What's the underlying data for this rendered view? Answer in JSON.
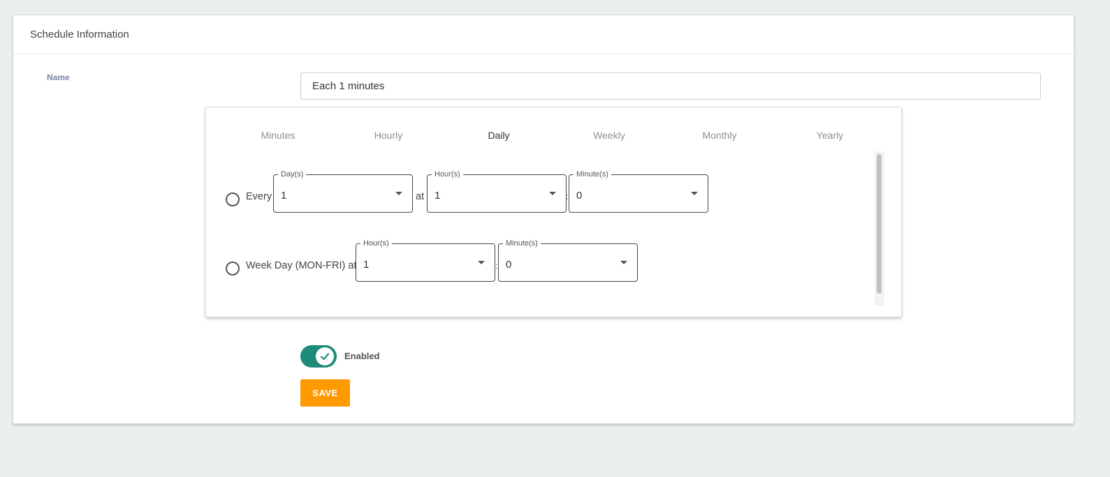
{
  "card": {
    "title": "Schedule Information"
  },
  "form": {
    "name_label": "Name",
    "name_value": "Each 1 minutes"
  },
  "cron": {
    "tabs": [
      {
        "label": "Minutes"
      },
      {
        "label": "Hourly"
      },
      {
        "label": "Daily"
      },
      {
        "label": "Weekly"
      },
      {
        "label": "Monthly"
      },
      {
        "label": "Yearly"
      }
    ],
    "active_tab": "Daily",
    "row1": {
      "prefix": "Every",
      "days": {
        "label": "Day(s)",
        "value": "1"
      },
      "at": "at",
      "hours": {
        "label": "Hour(s)",
        "value": "1"
      },
      "sep": ":",
      "minutes": {
        "label": "Minute(s)",
        "value": "0"
      }
    },
    "row2": {
      "prefix": "Week Day (MON-FRI) at",
      "hours": {
        "label": "Hour(s)",
        "value": "1"
      },
      "sep": ":",
      "minutes": {
        "label": "Minute(s)",
        "value": "0"
      }
    }
  },
  "toggle": {
    "label": "Enabled",
    "state": "on",
    "color": "#1d8a7a"
  },
  "save": {
    "label": "SAVE",
    "color": "#ff9900"
  }
}
